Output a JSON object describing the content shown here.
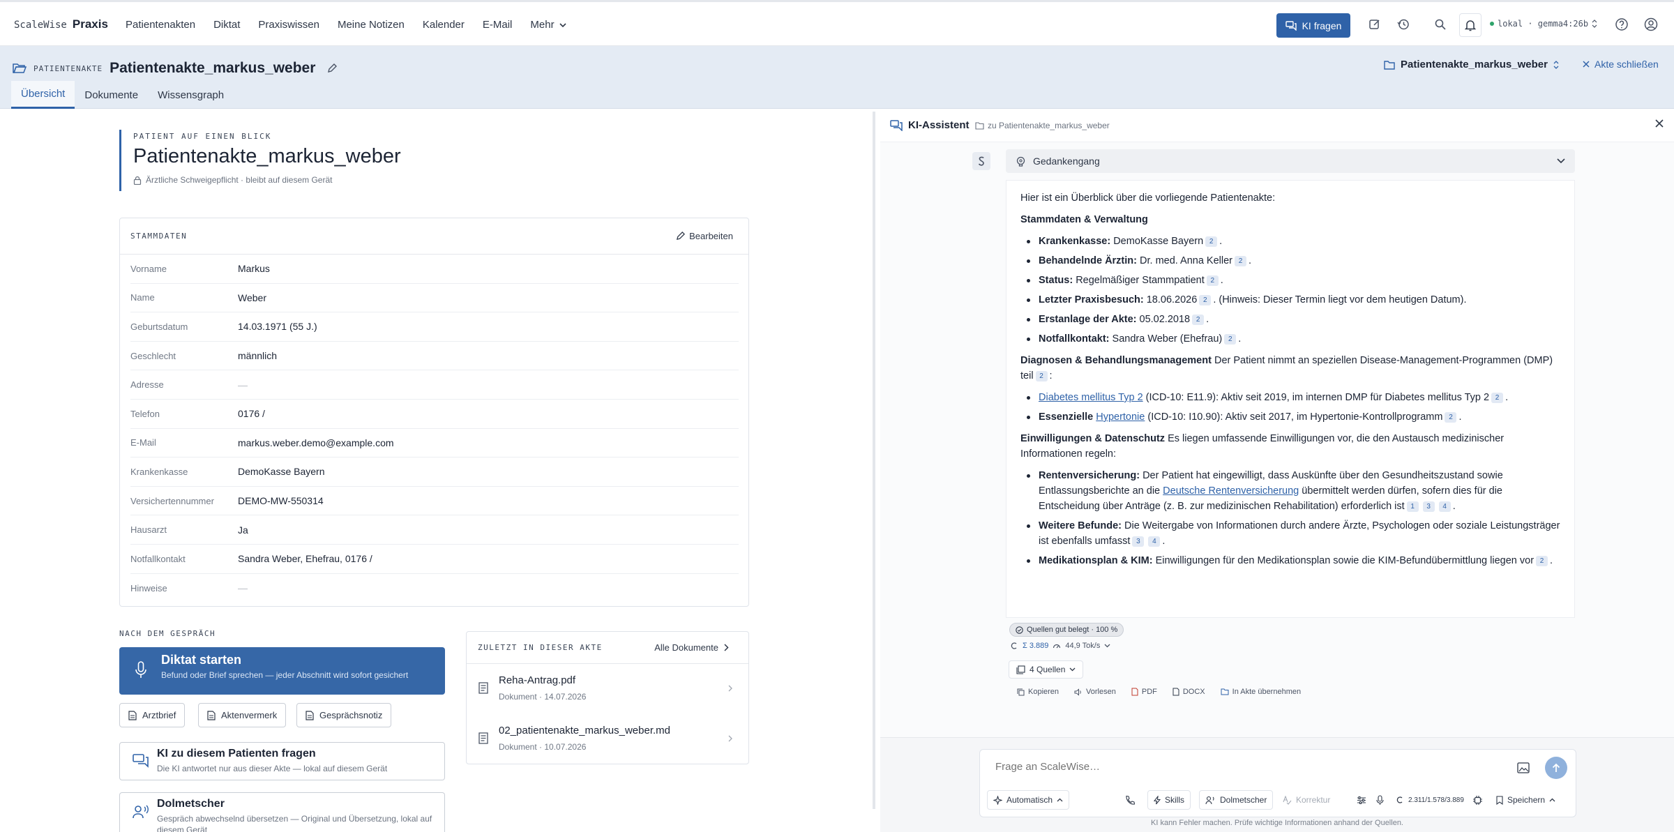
{
  "nav": {
    "brand_prefix": "ScaleWise",
    "brand_name": "Praxis",
    "links": [
      "Patientenakten",
      "Diktat",
      "Praxiswissen",
      "Meine Notizen",
      "Kalender",
      "E-Mail"
    ],
    "more_label": "Mehr",
    "ki_button": "KI fragen",
    "model": "lokal · gemma4:26b"
  },
  "record": {
    "caption": "PATIENTENAKTE",
    "title": "Patientenakte_markus_weber",
    "tabs": [
      "Übersicht",
      "Dokumente",
      "Wissensgraph"
    ],
    "active_tab": "Übersicht",
    "folder_selector": "Patientenakte_markus_weber",
    "close_label": "Akte schließen"
  },
  "glance": {
    "caption": "PATIENT AUF EINEN BLICK",
    "title": "Patientenakte_markus_weber",
    "privacy_note": "Ärztliche Schweigepflicht · bleibt auf diesem Gerät"
  },
  "stammdaten": {
    "caption": "STAMMDATEN",
    "edit_label": "Bearbeiten",
    "fields": [
      {
        "label": "Vorname",
        "value": "Markus"
      },
      {
        "label": "Name",
        "value": "Weber"
      },
      {
        "label": "Geburtsdatum",
        "value": "14.03.1971 (55 J.)"
      },
      {
        "label": "Geschlecht",
        "value": "männlich"
      },
      {
        "label": "Adresse",
        "value": "—"
      },
      {
        "label": "Telefon",
        "value": "0176 /"
      },
      {
        "label": "E-Mail",
        "value": "markus.weber.demo@example.com"
      },
      {
        "label": "Krankenkasse",
        "value": "DemoKasse Bayern"
      },
      {
        "label": "Versichertennummer",
        "value": "DEMO-MW-550314"
      },
      {
        "label": "Hausarzt",
        "value": "Ja"
      },
      {
        "label": "Notfallkontakt",
        "value": "Sandra Weber, Ehefrau, 0176 /"
      },
      {
        "label": "Hinweise",
        "value": "—"
      }
    ]
  },
  "after": {
    "caption": "NACH DEM GESPRÄCH",
    "diktat_title": "Diktat starten",
    "diktat_sub": "Befund oder Brief sprechen — jeder Abschnitt wird sofort gesichert",
    "buttons": [
      "Arztbrief",
      "Aktenvermerk",
      "Gesprächsnotiz"
    ],
    "ask_title": "KI zu diesem Patienten fragen",
    "ask_sub": "Die KI antwortet nur aus dieser Akte — lokal auf diesem Gerät",
    "interp_title": "Dolmetscher",
    "interp_sub": "Gespräch abwechselnd übersetzen — Original und Übersetzung, lokal auf diesem Gerät"
  },
  "recent": {
    "caption": "ZULETZT IN DIESER AKTE",
    "all_label": "Alle Dokumente",
    "docs": [
      {
        "name": "Reha-Antrag.pdf",
        "meta": "Dokument · 14.07.2026"
      },
      {
        "name": "02_patientenakte_markus_weber.md",
        "meta": "Dokument · 10.07.2026"
      }
    ]
  },
  "assistant": {
    "title": "KI-Assistent",
    "context": "zu Patientenakte_markus_weber",
    "thinking_label": "Gedankengang",
    "intro": "Hier ist ein Überblick über die vorliegende Patientenakte:",
    "section1": "Stammdaten & Verwaltung",
    "s1": [
      {
        "k": "Krankenkasse:",
        "v": "DemoKasse Bayern",
        "c": [
          "2"
        ],
        "t": "."
      },
      {
        "k": "Behandelnde Ärztin:",
        "v": "Dr. med. Anna Keller",
        "c": [
          "2"
        ],
        "t": "."
      },
      {
        "k": "Status:",
        "v": "Regelmäßiger Stammpatient",
        "c": [
          "2"
        ],
        "t": "."
      },
      {
        "k": "Letzter Praxisbesuch:",
        "v": "18.06.2026",
        "c": [
          "2"
        ],
        "t": ". (Hinweis: Dieser Termin liegt vor dem heutigen Datum)."
      },
      {
        "k": "Erstanlage der Akte:",
        "v": "05.02.2018",
        "c": [
          "2"
        ],
        "t": "."
      },
      {
        "k": "Notfallkontakt:",
        "v": "Sandra Weber (Ehefrau)",
        "c": [
          "2"
        ],
        "t": "."
      }
    ],
    "section2": "Diagnosen & Behandlungsmanagement",
    "section2_text": "Der Patient nimmt an speziellen Disease-Management-Programmen (DMP) teil",
    "diag1_link": "Diabetes mellitus Typ 2",
    "diag1_text": "(ICD-10: E11.9): Aktiv seit 2019, im internen DMP für Diabetes mellitus Typ 2",
    "diag2_prefix": "Essenzielle",
    "diag2_link": "Hypertonie",
    "diag2_text": "(ICD-10: I10.90): Aktiv seit 2017, im Hypertonie-Kontrollprogramm",
    "section3": "Einwilligungen & Datenschutz",
    "section3_text": "Es liegen umfassende Einwilligungen vor, die den Austausch medizinischer Informationen regeln:",
    "rv_k": "Rentenversicherung:",
    "rv_a": "Der Patient hat eingewilligt, dass Auskünfte über den Gesundheitszustand sowie Entlassungsberichte an die",
    "rv_link": "Deutsche Rentenversicherung",
    "rv_b": "übermittelt werden dürfen, sofern dies für die Entscheidung über Anträge (z. B. zur medizinischen Rehabilitation) erforderlich ist",
    "wb_k": "Weitere Befunde:",
    "wb_v": "Die Weitergabe von Informationen durch andere Ärzte, Psychologen oder soziale Leistungsträger ist ebenfalls umfasst",
    "mp_k": "Medikationsplan & KIM:",
    "mp_v": "Einwilligungen für den Medikationsplan sowie die KIM-Befundübermittlung liegen vor",
    "cite_1": "1",
    "cite_2": "2",
    "cite_3": "3",
    "cite_4": "4",
    "source_badge": "Quellen gut belegt · 100 %",
    "tokens": "Σ 3.889",
    "speed": "44,9 Tok/s",
    "sources_btn": "4 Quellen",
    "actions": [
      "Kopieren",
      "Vorlesen",
      "PDF",
      "DOCX",
      "In Akte übernehmen"
    ],
    "input_placeholder": "Frage an ScaleWise…",
    "tools": {
      "auto": "Automatisch",
      "skills": "Skills",
      "interp": "Dolmetscher",
      "correct": "Korrektur",
      "ctx": "2.311/1.578/3.889",
      "save": "Speichern"
    },
    "disclaimer": "KI kann Fehler machen. Prüfe wichtige Informationen anhand der Quellen."
  },
  "colors": {
    "accent": "#2f62a8",
    "header_bg": "#e4ebf4",
    "diktat_bg": "#3667a7"
  }
}
